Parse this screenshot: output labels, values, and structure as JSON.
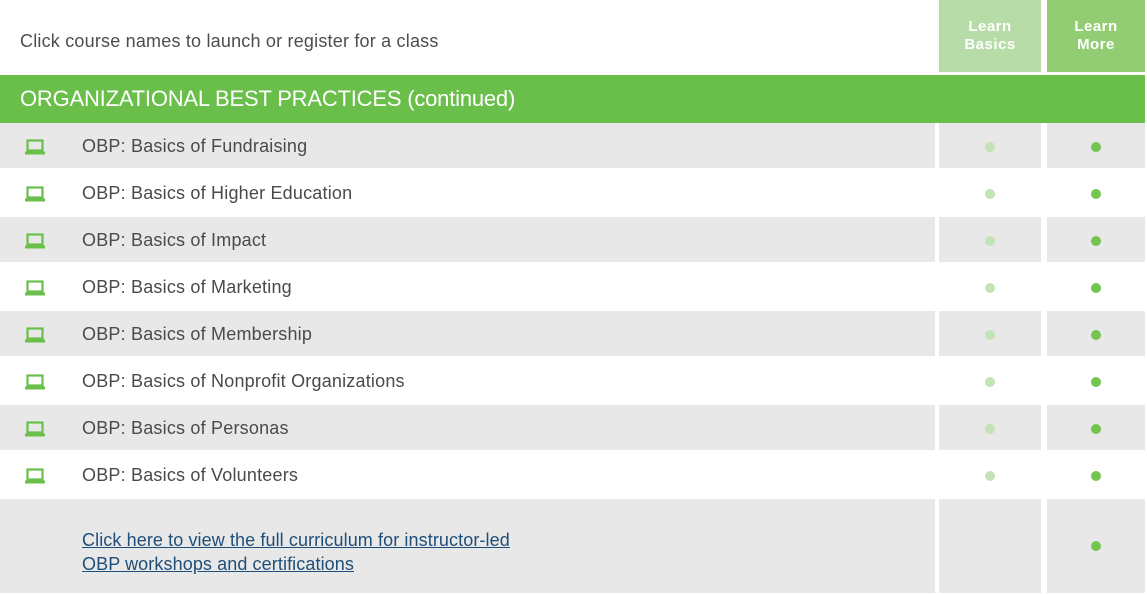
{
  "intro_text": "Click course names to launch or register for a class",
  "columns": {
    "basics_label_1": "Learn",
    "basics_label_2": "Basics",
    "more_label_1": "Learn",
    "more_label_2": "More"
  },
  "section_title": "ORGANIZATIONAL BEST PRACTICES (continued)",
  "courses": [
    {
      "name": "OBP: Basics of Fundraising",
      "learn_basics": true,
      "learn_more": true
    },
    {
      "name": "OBP: Basics of Higher Education",
      "learn_basics": true,
      "learn_more": true
    },
    {
      "name": "OBP: Basics of Impact",
      "learn_basics": true,
      "learn_more": true
    },
    {
      "name": "OBP: Basics of Marketing",
      "learn_basics": true,
      "learn_more": true
    },
    {
      "name": "OBP: Basics of Membership",
      "learn_basics": true,
      "learn_more": true
    },
    {
      "name": "OBP: Basics of Nonprofit Organizations",
      "learn_basics": true,
      "learn_more": true
    },
    {
      "name": "OBP: Basics of Personas",
      "learn_basics": true,
      "learn_more": true
    },
    {
      "name": "OBP: Basics of Volunteers",
      "learn_basics": true,
      "learn_more": true
    }
  ],
  "curriculum_link": {
    "line1": "Click here to view the full curriculum for instructor-led",
    "line2": "OBP workshops and certifications",
    "learn_basics": false,
    "learn_more": true
  },
  "icon": "laptop-icon",
  "colors": {
    "section_green": "#6abf4b",
    "basics_header": "#b7dca7",
    "more_header": "#93cd73",
    "dot_light": "#c4e3b5",
    "dot_dark": "#74c450",
    "link_blue": "#1f4e79"
  }
}
